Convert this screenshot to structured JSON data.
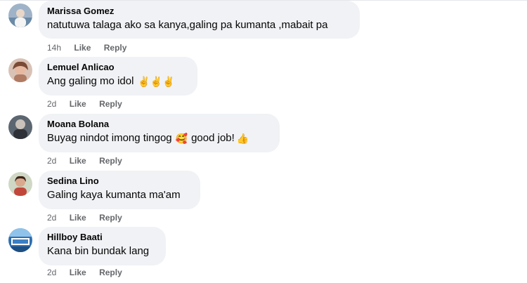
{
  "comments": [
    {
      "name": "Marissa Gomez",
      "text": "natutuwa talaga ako sa kanya,galing pa kumanta ,mabait pa",
      "emoji": "",
      "text2": "",
      "emoji2": "",
      "time": "14h",
      "like": "Like",
      "reply": "Reply",
      "avatar_icon": "avatar-photo"
    },
    {
      "name": "Lemuel Anlicao",
      "text": "Ang galing mo idol",
      "emoji": "✌️✌️✌️",
      "text2": "",
      "emoji2": "",
      "time": "2d",
      "like": "Like",
      "reply": "Reply",
      "avatar_icon": "avatar-photo"
    },
    {
      "name": "Moana Bolana",
      "text": "Buyag nindot imong tingog",
      "emoji": "🥰",
      "text2": "good job!",
      "emoji2": "👍",
      "time": "2d",
      "like": "Like",
      "reply": "Reply",
      "avatar_icon": "avatar-photo"
    },
    {
      "name": "Sedina Lino",
      "text": "Galing kaya kumanta ma'am",
      "emoji": "",
      "text2": "",
      "emoji2": "",
      "time": "2d",
      "like": "Like",
      "reply": "Reply",
      "avatar_icon": "avatar-photo"
    },
    {
      "name": "Hillboy Baati",
      "text": "Kana bin bundak lang",
      "emoji": "",
      "text2": "",
      "emoji2": "",
      "time": "2d",
      "like": "Like",
      "reply": "Reply",
      "avatar_icon": "avatar-photo"
    }
  ],
  "colors": {
    "bubble_bg": "#f0f2f5",
    "text": "#050505",
    "meta": "#65676b"
  }
}
